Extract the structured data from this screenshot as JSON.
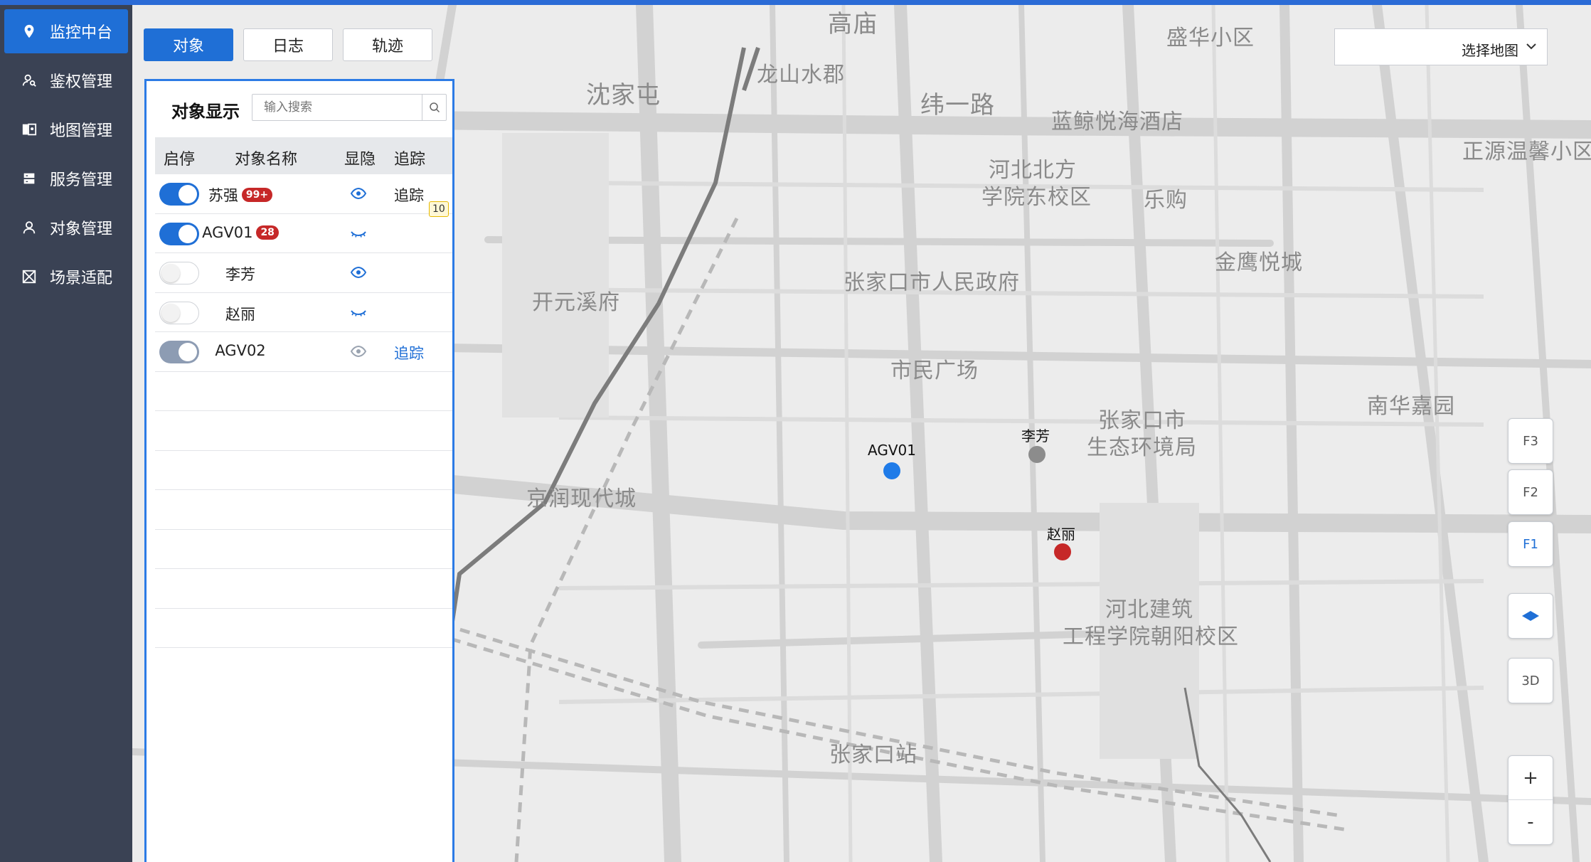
{
  "sidebar": {
    "items": [
      {
        "label": "监控中台",
        "icon": "location-pin-icon",
        "active": true
      },
      {
        "label": "鉴权管理",
        "icon": "user-key-icon",
        "active": false
      },
      {
        "label": "地图管理",
        "icon": "map-icon",
        "active": false
      },
      {
        "label": "服务管理",
        "icon": "server-icon",
        "active": false
      },
      {
        "label": "对象管理",
        "icon": "user-icon",
        "active": false
      },
      {
        "label": "场景适配",
        "icon": "scene-icon",
        "active": false
      }
    ]
  },
  "tabs": [
    {
      "label": "对象",
      "active": true
    },
    {
      "label": "日志",
      "active": false
    },
    {
      "label": "轨迹",
      "active": false
    }
  ],
  "panel": {
    "title": "对象显示",
    "search_placeholder": "输入搜索",
    "columns": [
      "启停",
      "对象名称",
      "显隐",
      "追踪"
    ],
    "rows": [
      {
        "enabled": "on",
        "name": "苏强",
        "badge": "99+",
        "visible": true,
        "track": "追踪",
        "track_count": "10"
      },
      {
        "enabled": "on",
        "name": "AGV01",
        "badge": "28",
        "visible": false,
        "track": ""
      },
      {
        "enabled": "off",
        "name": "李芳",
        "badge": "",
        "visible": true,
        "track": ""
      },
      {
        "enabled": "off",
        "name": "赵丽",
        "badge": "",
        "visible": false,
        "track": ""
      },
      {
        "enabled": "disabled-on",
        "name": "AGV02",
        "badge": "",
        "visible": true,
        "track": "追踪"
      }
    ]
  },
  "map_select": {
    "label": "选择地图"
  },
  "map": {
    "labels": [
      "高庙",
      "盛华小区",
      "龙山水郡",
      "沈家屯",
      "纬一路",
      "蓝鲸悦海酒店",
      "正源温馨小区",
      "河北北方",
      "学院东校区",
      "乐购",
      "金鹰悦城",
      "张家口市人民政府",
      "开元溪府",
      "市民广场",
      "南华嘉园",
      "张家口市",
      "生态环境局",
      "京润现代城",
      "河北建筑",
      "工程学院朝阳校区",
      "张家口站"
    ],
    "markers": [
      {
        "name": "AGV01",
        "color": "#1f7be8"
      },
      {
        "name": "李芳",
        "color": "#8c8c8c"
      },
      {
        "name": "赵丽",
        "color": "#c62828"
      }
    ]
  },
  "controls": {
    "floors": [
      "F3",
      "F2",
      "F1"
    ],
    "active_floor": "F1",
    "view_3d": "3D",
    "zoom_in": "+",
    "zoom_out": "-"
  },
  "colors": {
    "primary": "#1f6fd6",
    "sidebar": "#3a4254",
    "badge": "#c62828"
  }
}
